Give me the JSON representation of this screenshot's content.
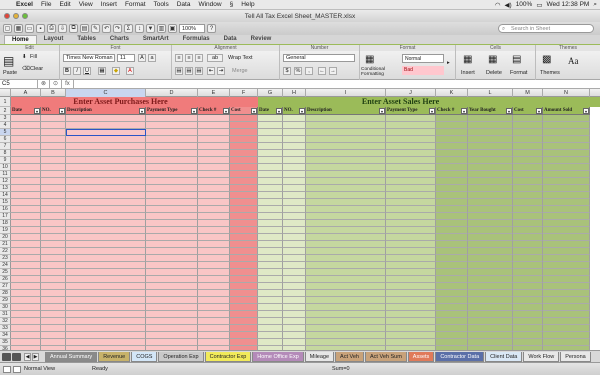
{
  "menubar": {
    "app": "Excel",
    "items": [
      "File",
      "Edit",
      "View",
      "Insert",
      "Format",
      "Tools",
      "Data",
      "Window",
      "Help"
    ],
    "status": {
      "battery": "100%",
      "clock": "Wed 12:38 PM"
    }
  },
  "window": {
    "title": "Tell All Tax Excel Sheet_MASTER.xlsx"
  },
  "toolbar": {
    "zoom": "100%",
    "search_placeholder": "Search in Sheet"
  },
  "ribbon": {
    "tabs": [
      "Home",
      "Layout",
      "Tables",
      "Charts",
      "SmartArt",
      "Formulas",
      "Data",
      "Review"
    ],
    "active_tab": "Home",
    "groups": {
      "edit": "Edit",
      "font": "Font",
      "alignment": "Alignment",
      "number": "Number",
      "format": "Format",
      "cells": "Cells",
      "themes": "Themes"
    },
    "paste": "Paste",
    "fill": "Fill",
    "clear": "Clear",
    "font_name": "Times New Roman",
    "font_size": "11",
    "wrap_text": "Wrap Text",
    "merge": "Merge",
    "number_format": "General",
    "conditional_formatting": "Conditional Formatting",
    "style_normal": "Normal",
    "style_bad": "Bad",
    "insert": "Insert",
    "delete": "Delete",
    "format": "Format",
    "themes": "Themes",
    "aa": "Aa"
  },
  "formula_bar": {
    "name_box": "C5",
    "fx": "fx",
    "value": ""
  },
  "columns": [
    "A",
    "B",
    "C",
    "D",
    "E",
    "F",
    "G",
    "H",
    "I",
    "J",
    "K",
    "L",
    "M",
    "N"
  ],
  "purchases": {
    "title": "Enter Asset Purchases Here",
    "headers": [
      "Date",
      "NO.",
      "Description",
      "Payment Type",
      "Check #",
      "Cost"
    ]
  },
  "sales": {
    "title": "Enter Asset Sales Here",
    "headers": [
      "Date",
      "NO.",
      "Description",
      "Payment Type",
      "Check #",
      "Year Bought",
      "Cost",
      "Amount Sold"
    ]
  },
  "row_numbers": [
    "1",
    "2",
    "3",
    "4",
    "5",
    "6",
    "7",
    "8",
    "9",
    "10",
    "11",
    "12",
    "13",
    "14",
    "15",
    "16",
    "17",
    "18",
    "19",
    "20",
    "21",
    "22",
    "23",
    "24",
    "25",
    "26",
    "27",
    "28",
    "29",
    "30",
    "31",
    "32",
    "33",
    "34",
    "35",
    "36"
  ],
  "sheet_tabs": [
    {
      "label": "Annual Summary",
      "color": "#8a8a8a"
    },
    {
      "label": "Revenue",
      "color": "#c7b26a"
    },
    {
      "label": "COGS",
      "color": "#d3e6f7"
    },
    {
      "label": "Operation Exp",
      "color": "#c9c9c9"
    },
    {
      "label": "Contractor Exp",
      "color": "#f1ea5a"
    },
    {
      "label": "Home Office Exp",
      "color": "#b48ab9"
    },
    {
      "label": "Mileage",
      "color": "#e6e6e6"
    },
    {
      "label": "Act Veh",
      "color": "#c8a27a"
    },
    {
      "label": "Act Veh Sum",
      "color": "#c8a27a"
    },
    {
      "label": "Assets",
      "color": "#e07a5a"
    },
    {
      "label": "Contractor Data",
      "color": "#5b6fa8"
    },
    {
      "label": "Client Data",
      "color": "#d9e7f5"
    },
    {
      "label": "Work Flow",
      "color": "#e8e8e8"
    },
    {
      "label": "Persona",
      "color": "#e8e8e8"
    }
  ],
  "status_bar": {
    "view": "Normal View",
    "state": "Ready",
    "sum": "Sum=0"
  },
  "colors": {
    "purchase_light": "#f9c6c6",
    "purchase_dark": "#f08f8f",
    "purchase_header": "#f07b7b",
    "sales_light": "#dfe9c6",
    "sales_dark": "#a9c27a",
    "sales_header": "#9bbb59"
  }
}
